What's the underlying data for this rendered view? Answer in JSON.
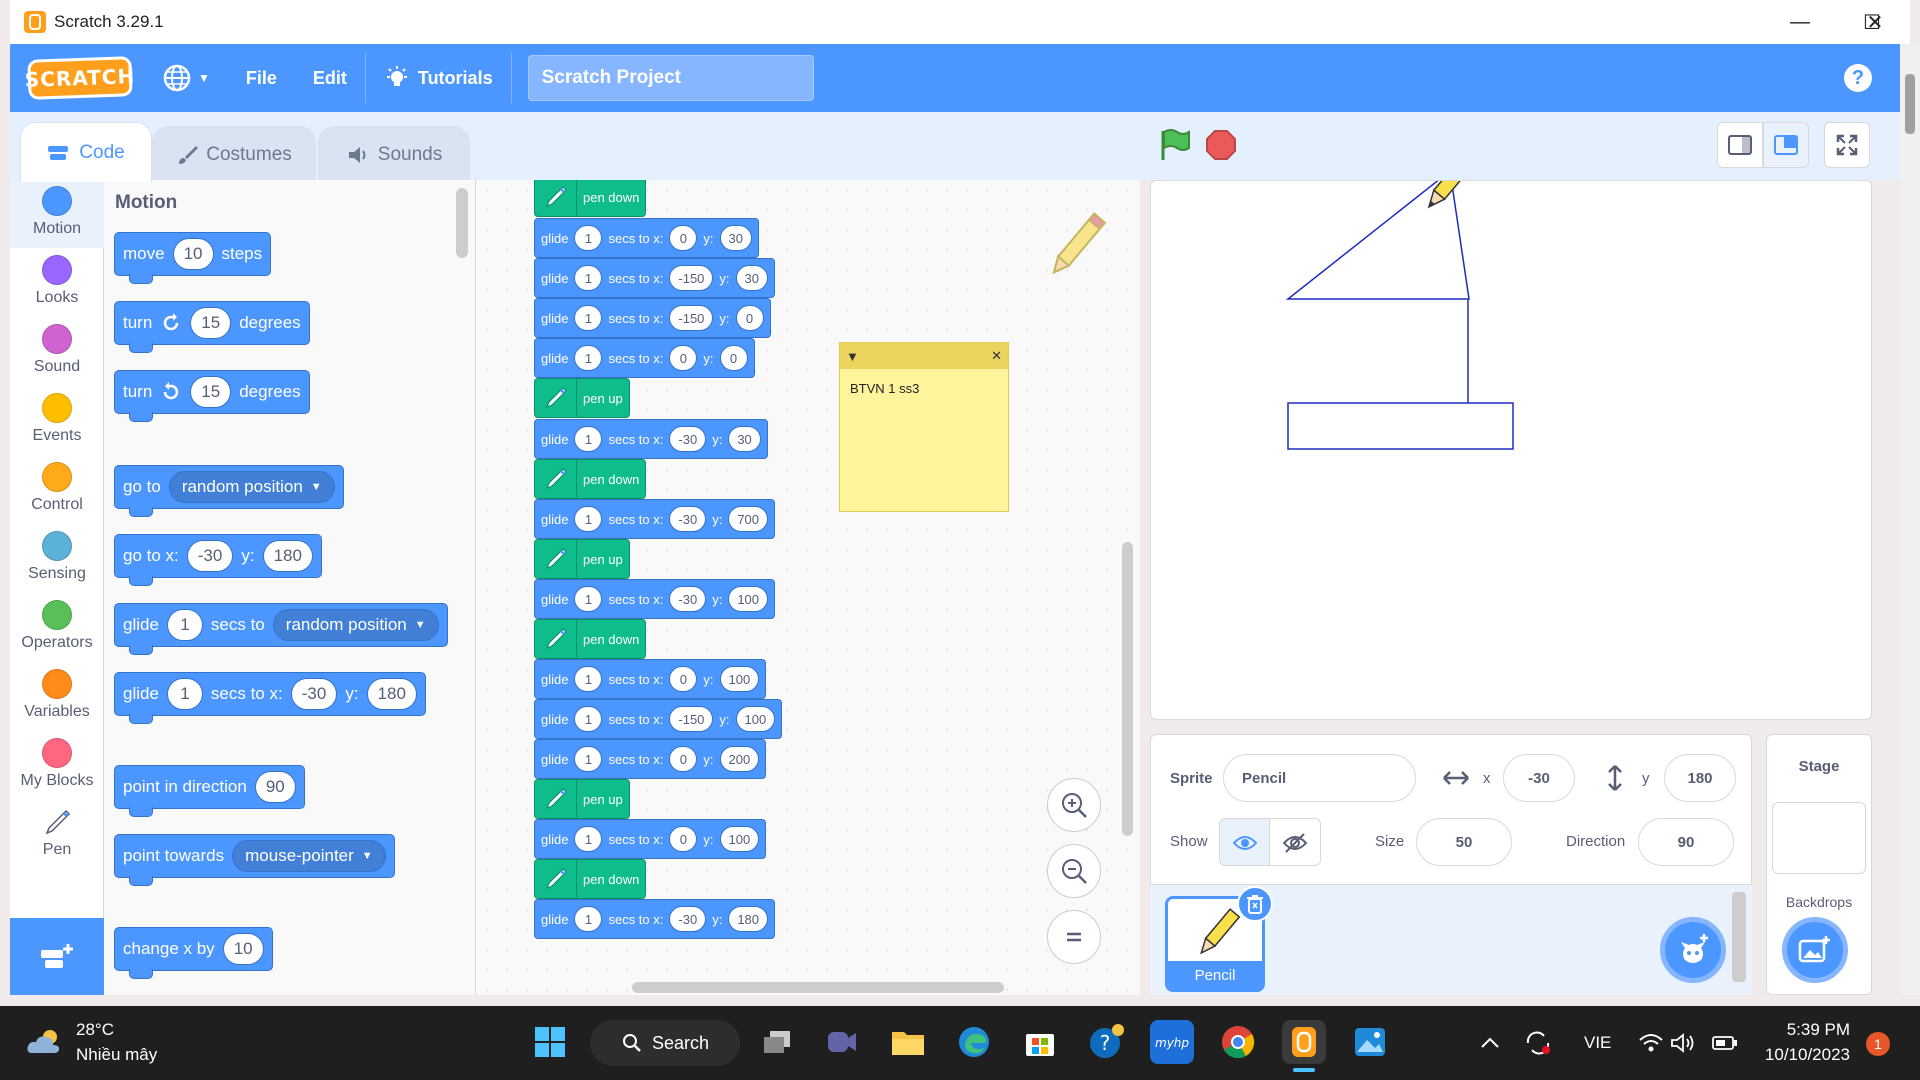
{
  "window": {
    "title": "Scratch 3.29.1"
  },
  "menubar": {
    "logo": "SCRATCH",
    "file": "File",
    "edit": "Edit",
    "tutorials": "Tutorials",
    "project_title": "Scratch Project",
    "help": "?"
  },
  "tabs": {
    "code": "Code",
    "costumes": "Costumes",
    "sounds": "Sounds"
  },
  "categories": [
    {
      "label": "Motion",
      "color": "#4c97ff"
    },
    {
      "label": "Looks",
      "color": "#9966ff"
    },
    {
      "label": "Sound",
      "color": "#cf63cf"
    },
    {
      "label": "Events",
      "color": "#ffbf00"
    },
    {
      "label": "Control",
      "color": "#ffab19"
    },
    {
      "label": "Sensing",
      "color": "#5cb1d6"
    },
    {
      "label": "Operators",
      "color": "#59c059"
    },
    {
      "label": "Variables",
      "color": "#ff8c1a"
    },
    {
      "label": "My Blocks",
      "color": "#ff6680"
    },
    {
      "label": "Pen",
      "color": "#0fbd8c"
    }
  ],
  "palette": {
    "title": "Motion",
    "move": {
      "a": "move",
      "v": "10",
      "b": "steps"
    },
    "turn_right": {
      "a": "turn",
      "v": "15",
      "b": "degrees"
    },
    "turn_left": {
      "a": "turn",
      "v": "15",
      "b": "degrees"
    },
    "goto": {
      "a": "go to",
      "d": "random position"
    },
    "gotoxy": {
      "a": "go to x:",
      "x": "-30",
      "b": "y:",
      "y": "180"
    },
    "glide_to": {
      "a": "glide",
      "v": "1",
      "b": "secs to",
      "d": "random position"
    },
    "glide_xy": {
      "a": "glide",
      "v": "1",
      "b": "secs to x:",
      "x": "-30",
      "c": "y:",
      "y": "180"
    },
    "point_dir": {
      "a": "point in direction",
      "v": "90"
    },
    "point_towards": {
      "a": "point towards",
      "d": "mouse-pointer"
    },
    "change_x": {
      "a": "change x by",
      "v": "10"
    }
  },
  "script": {
    "labels": {
      "glide": "glide",
      "secs": "secs to x:",
      "y": "y:",
      "pen_down": "pen down",
      "pen_up": "pen up"
    },
    "blocks": [
      {
        "type": "pen",
        "label": "pen down"
      },
      {
        "type": "glide",
        "s": "1",
        "x": "0",
        "y": "30"
      },
      {
        "type": "glide",
        "s": "1",
        "x": "-150",
        "y": "30"
      },
      {
        "type": "glide",
        "s": "1",
        "x": "-150",
        "y": "0"
      },
      {
        "type": "glide",
        "s": "1",
        "x": "0",
        "y": "0"
      },
      {
        "type": "pen",
        "label": "pen up"
      },
      {
        "type": "glide",
        "s": "1",
        "x": "-30",
        "y": "30"
      },
      {
        "type": "pen",
        "label": "pen down"
      },
      {
        "type": "glide",
        "s": "1",
        "x": "-30",
        "y": "700"
      },
      {
        "type": "pen",
        "label": "pen up"
      },
      {
        "type": "glide",
        "s": "1",
        "x": "-30",
        "y": "100"
      },
      {
        "type": "pen",
        "label": "pen down"
      },
      {
        "type": "glide",
        "s": "1",
        "x": "0",
        "y": "100"
      },
      {
        "type": "glide",
        "s": "1",
        "x": "-150",
        "y": "100"
      },
      {
        "type": "glide",
        "s": "1",
        "x": "0",
        "y": "200"
      },
      {
        "type": "pen",
        "label": "pen up"
      },
      {
        "type": "glide",
        "s": "1",
        "x": "0",
        "y": "100"
      },
      {
        "type": "pen",
        "label": "pen down"
      },
      {
        "type": "glide",
        "s": "1",
        "x": "-30",
        "y": "180"
      }
    ],
    "note": "BTVN 1 ss3"
  },
  "sprite_info": {
    "sprite_label": "Sprite",
    "sprite_name": "Pencil",
    "x_label": "x",
    "x": "-30",
    "y_label": "y",
    "y": "180",
    "show_label": "Show",
    "size_label": "Size",
    "size": "50",
    "direction_label": "Direction",
    "direction": "90",
    "sprite_tile_name": "Pencil"
  },
  "stage_pane": {
    "title": "Stage",
    "backdrops": "Backdrops"
  },
  "taskbar": {
    "temp": "28°C",
    "weather": "Nhiều mây",
    "search": "Search",
    "lang": "VIE",
    "time": "5:39 PM",
    "date": "10/10/2023",
    "notif": "1"
  },
  "colors": {
    "accent": "#4c97ff",
    "motion": "#4c97ff",
    "pen": "#0fbd8c"
  }
}
